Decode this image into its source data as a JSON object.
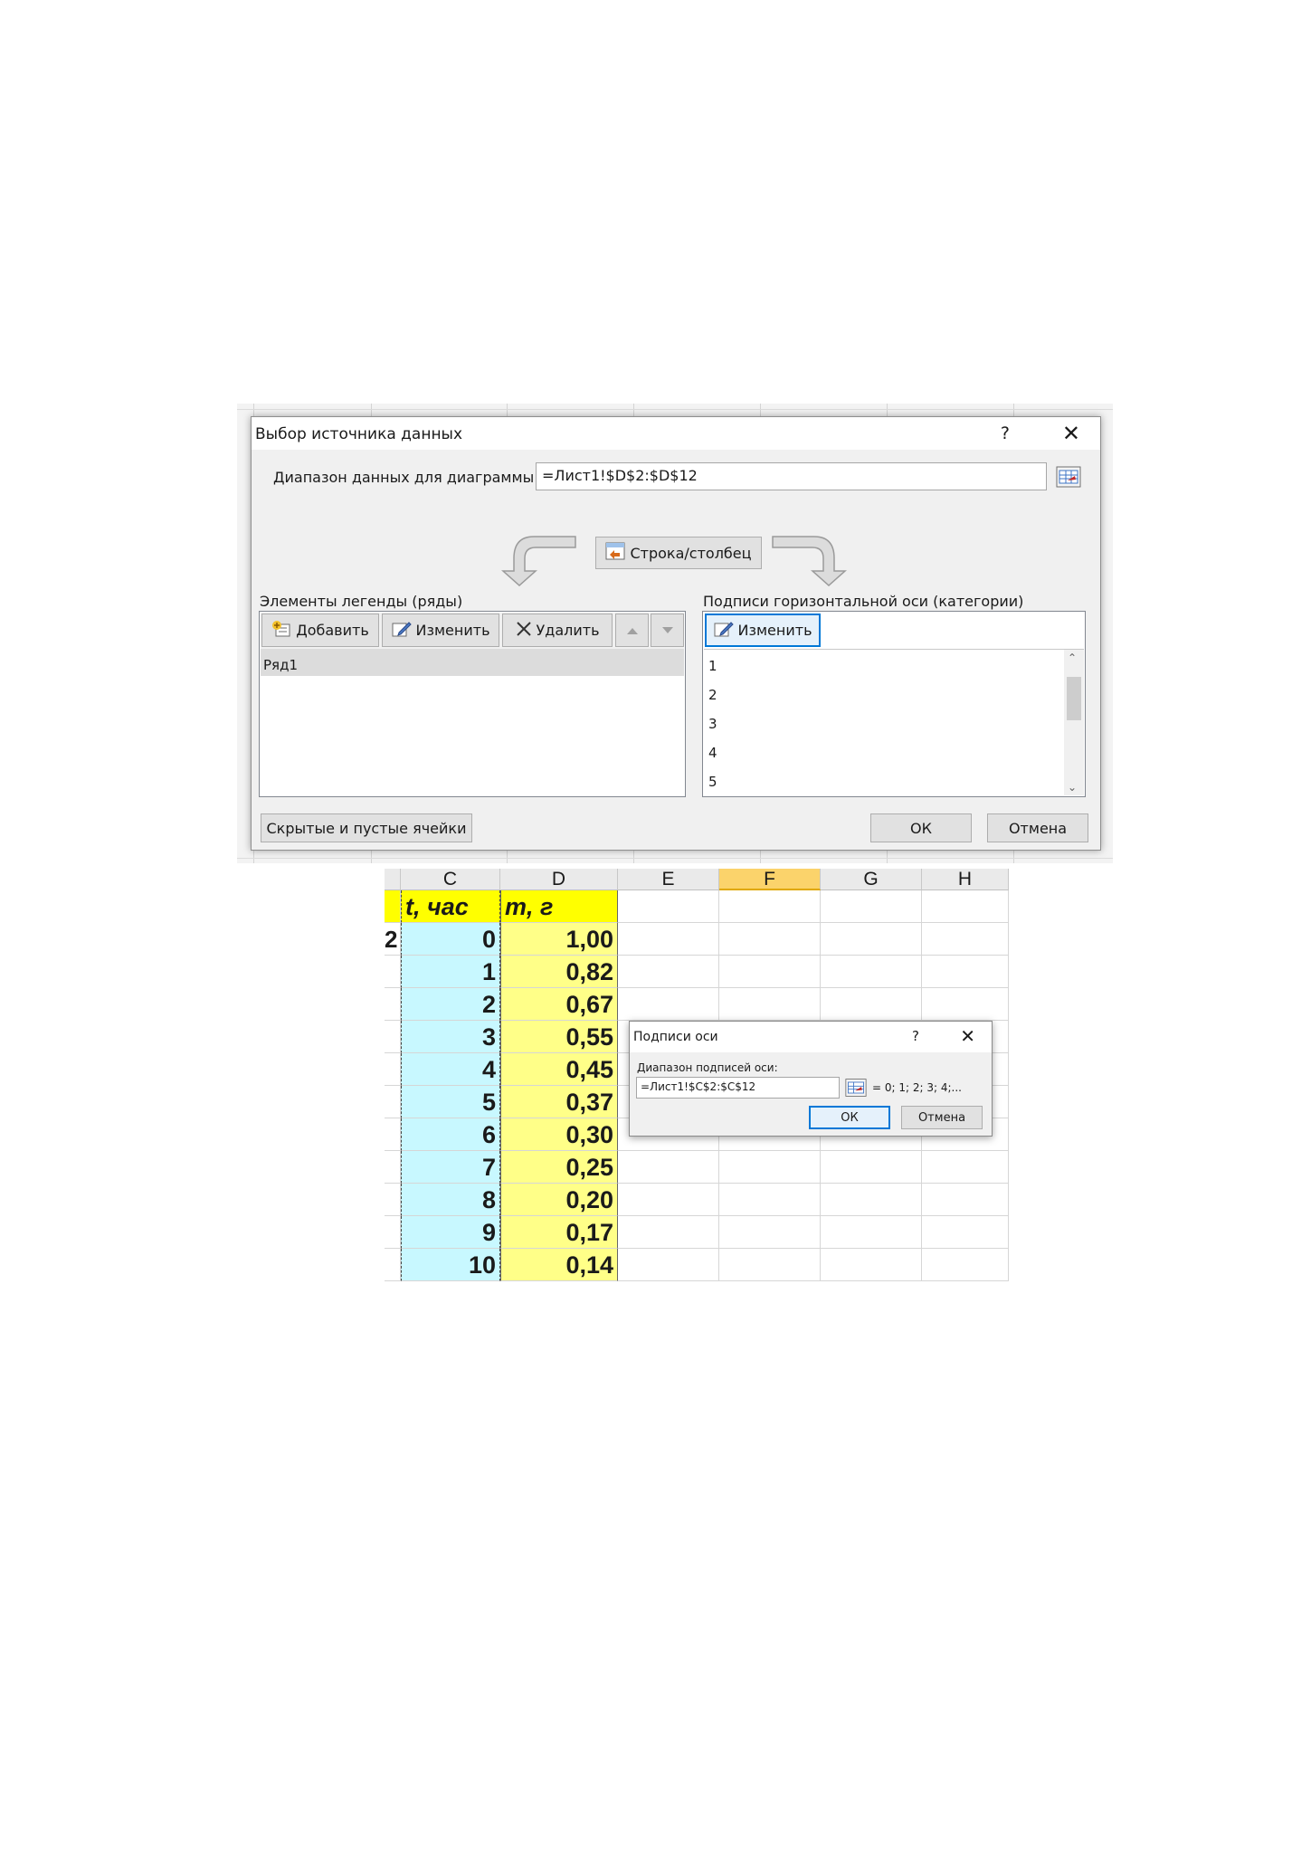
{
  "dialog": {
    "title": "Выбор источника данных",
    "help": "?",
    "close": "✕",
    "range_label": "Диапазон данных для диаграммы:",
    "range_value": "=Лист1!$D$2:$D$12",
    "switch_button": "Строка/столбец",
    "legend": {
      "title": "Элементы легенды (ряды)",
      "add": "Добавить",
      "edit": "Изменить",
      "delete": "Удалить",
      "items": [
        "Ряд1"
      ]
    },
    "categories": {
      "title": "Подписи горизонтальной оси (категории)",
      "edit": "Изменить",
      "items": [
        "1",
        "2",
        "3",
        "4",
        "5"
      ]
    },
    "hidden_cells_button": "Скрытые и пустые ячейки",
    "ok": "ОК",
    "cancel": "Отмена"
  },
  "sheet": {
    "columns": [
      "C",
      "D",
      "E",
      "F",
      "G",
      "H"
    ],
    "selected_column": "F",
    "row_number_partial": "2",
    "header_c": "t, час",
    "header_d": "m, г",
    "c_values": [
      "0",
      "1",
      "2",
      "3",
      "4",
      "5",
      "6",
      "7",
      "8",
      "9",
      "10"
    ],
    "d_values": [
      "1,00",
      "0,82",
      "0,67",
      "0,55",
      "0,45",
      "0,37",
      "0,30",
      "0,25",
      "0,20",
      "0,17",
      "0,14"
    ]
  },
  "axis_dialog": {
    "title": "Подписи оси",
    "help": "?",
    "close": "✕",
    "range_label": "Диапазон подписей оси:",
    "range_value": "=Лист1!$C$2:$C$12",
    "preview": "= 0; 1; 2; 3; 4;...",
    "ok": "ОК",
    "cancel": "Отмена"
  },
  "colors": {
    "c_fill": "#c8f8ff",
    "d_fill": "#ffff88",
    "header_fill": "#ffff00",
    "selected_col": "#fbd36b",
    "focus_blue": "#0078d7"
  }
}
